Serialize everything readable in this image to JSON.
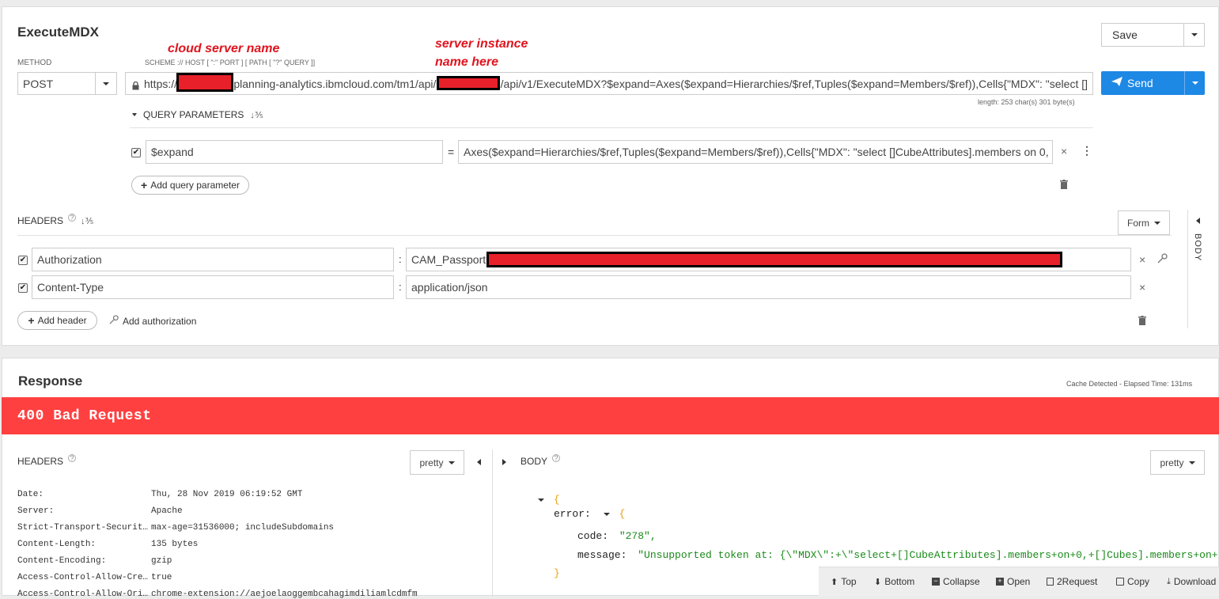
{
  "request": {
    "title": "ExecuteMDX",
    "method_label": "METHOD",
    "method_value": "POST",
    "scheme_label": "SCHEME :// HOST [ \":\" PORT ] [ PATH [ \"?\" QUERY ]]",
    "url_prefix": "https://",
    "url_host": "planning-analytics.ibmcloud.com/tm1/api/",
    "url_rest": "/api/v1/ExecuteMDX?$expand=Axes($expand=Hierarchies/$ref,Tuples($expand=Members/$ref)),Cells{\"MDX\": \"select []",
    "length_info": "length: 253 char(s) 301 byte(s)",
    "save_label": "Save",
    "send_label": "Send",
    "query_params_label": "QUERY PARAMETERS",
    "query_param": {
      "name": "$expand",
      "eq": "=",
      "value": "Axes($expand=Hierarchies/$ref,Tuples($expand=Members/$ref)),Cells{\"MDX\": \"select []CubeAttributes].members on 0,"
    },
    "add_query_param_label": "Add query parameter",
    "headers_label": "HEADERS",
    "form_label": "Form",
    "body_side_label": "BODY",
    "headers": [
      {
        "name": "Authorization",
        "value": "CAM_Passport"
      },
      {
        "name": "Content-Type",
        "value": "application/json"
      }
    ],
    "add_header_label": "Add header",
    "add_auth_label": "Add authorization"
  },
  "annotations": {
    "cloud_server": "cloud server name",
    "instance_line1": "server instance",
    "instance_line2": "name here"
  },
  "response": {
    "title": "Response",
    "cache_info": "Cache Detected - Elapsed Time: 131ms",
    "status": "400 Bad Request",
    "status_color": "#ff4040",
    "headers_label": "HEADERS",
    "pretty_label": "pretty",
    "body_label": "BODY",
    "headers": [
      {
        "key": "Date:",
        "value": "Thu, 28 Nov 2019 06:19:52 GMT"
      },
      {
        "key": "Server:",
        "value": "Apache"
      },
      {
        "key": "Strict-Transport-Securit…",
        "value": "max-age=31536000; includeSubdomains"
      },
      {
        "key": "Content-Length:",
        "value": "135 bytes"
      },
      {
        "key": "Content-Encoding:",
        "value": "gzip"
      },
      {
        "key": "Access-Control-Allow-Cre…",
        "value": "true"
      },
      {
        "key": "Access-Control-Allow-Ori…",
        "value": "chrome-extension://aejoelaoggembcahagimdiliamlcdmfm"
      }
    ],
    "body": {
      "open_brace": "{",
      "error_key": "error:",
      "code_key": "code:",
      "code_value": "\"278\",",
      "message_key": "message:",
      "message_value": "\"Unsupported token at: {\\\"MDX\\\":+\\\"select+[]CubeAttributes].members+on+0,+[]Cubes].members+on+",
      "inner_close": "}",
      "outer_close": "}"
    },
    "toolbar": [
      "Top",
      "Bottom",
      "Collapse",
      "Open",
      "2Request",
      "Copy",
      "Download"
    ]
  }
}
